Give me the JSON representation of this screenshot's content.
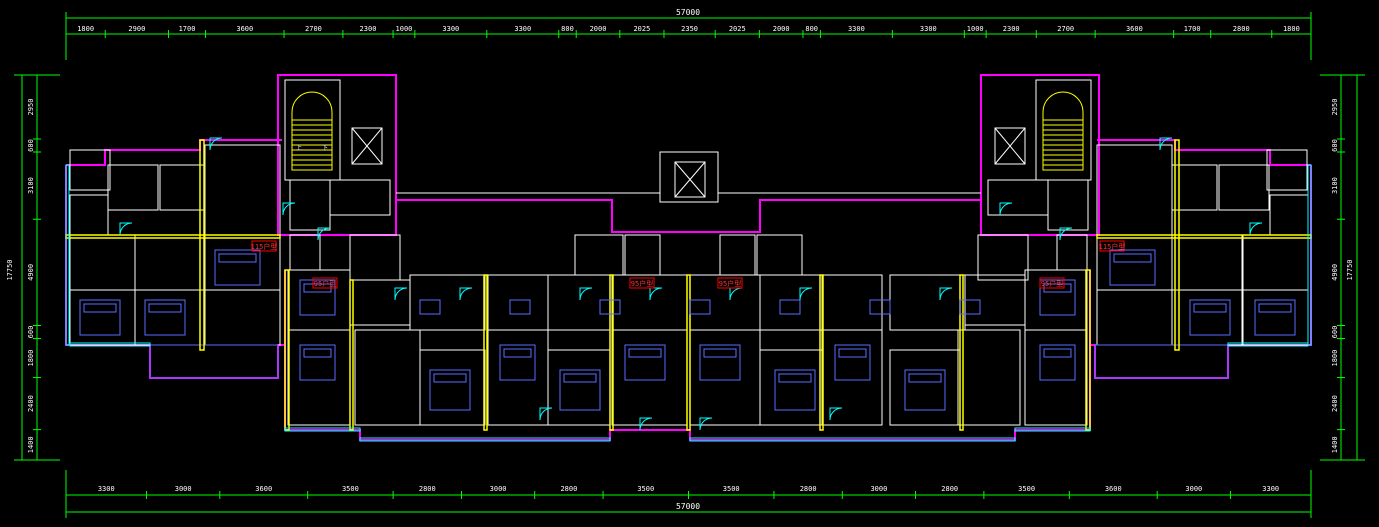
{
  "colors": {
    "background": "#000000",
    "dimension": "#00ff00",
    "dim_text": "#ffffff",
    "wall_magenta": "#ff00ff",
    "wall_white": "#ffffff",
    "window_cyan": "#00ffff",
    "furniture_blue": "#5a6cff",
    "accent_yellow": "#ffff00",
    "tag_red": "#ff0000",
    "area_red": "#ff3333"
  },
  "dims": {
    "top_total": "57000",
    "bottom_total": "57000",
    "top_segments": [
      "1800",
      "2900",
      "1700",
      "3600",
      "2700",
      "2300",
      "1000",
      "3300",
      "3300",
      "800",
      "2000",
      "2025",
      "2350",
      "2025",
      "2000",
      "800",
      "3300",
      "3300",
      "1000",
      "2300",
      "2700",
      "3600",
      "1700",
      "2800",
      "1800"
    ],
    "bottom_segments": [
      "3300",
      "3000",
      "3600",
      "3500",
      "2800",
      "3000",
      "2800",
      "3500",
      "3500",
      "2800",
      "3000",
      "2800",
      "3500",
      "3600",
      "3000",
      "3300"
    ],
    "left_outer": "17750",
    "left_segments": [
      "2950",
      "600",
      "3100",
      "4900",
      "600",
      "1800",
      "2400",
      "1400"
    ],
    "right_outer": "17750",
    "right_segments": [
      "2950",
      "600",
      "3100",
      "4900",
      "600",
      "1800",
      "2400",
      "1400"
    ]
  },
  "unit_tags": [
    "115户型",
    "95户型",
    "95户型",
    "95户型",
    "95户型",
    "115户型"
  ],
  "stair_labels": {
    "up": "上",
    "down": "下"
  },
  "icons": {
    "stair": "stair-icon",
    "elevator": "elevator-icon",
    "north": "none"
  }
}
